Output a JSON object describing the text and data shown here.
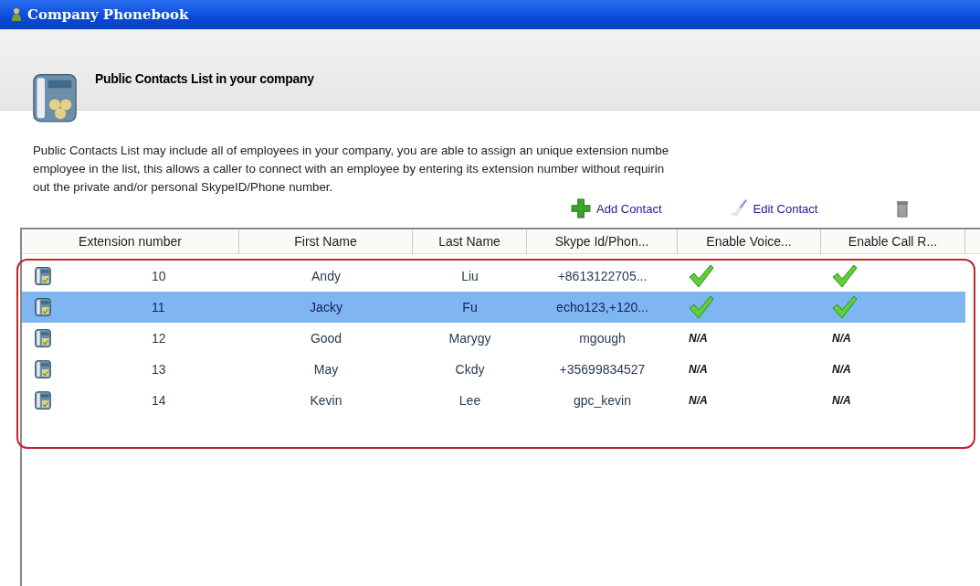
{
  "window": {
    "title": "Company Phonebook"
  },
  "header": {
    "title": "Public Contacts List in your company"
  },
  "description": [
    "Public Contacts List may include all of employees in your company, you are able to assign an unique extension numbe",
    "employee in the list, this allows a caller to connect with an employee by entering its extension number without requirin",
    "out the private and/or personal SkypeID/Phone number."
  ],
  "toolbar": [
    {
      "kind": "add",
      "label": "Add Contact"
    },
    {
      "kind": "edit",
      "label": "Edit Contact"
    },
    {
      "kind": "delete"
    }
  ],
  "table": {
    "columns": [
      "Extension number",
      "First Name",
      "Last Name",
      "Skype Id/Phon...",
      "Enable Voice...",
      "Enable Call R..."
    ],
    "rows": [
      {
        "selected": false,
        "extension": "10",
        "first_name": "Andy",
        "last_name": "Liu",
        "skype": "+8613122705...",
        "voice": {
          "kind": "check"
        },
        "call": {
          "kind": "check"
        }
      },
      {
        "selected": true,
        "extension": "11",
        "first_name": "Jacky",
        "last_name": "Fu",
        "skype": "echo123,+120...",
        "voice": {
          "kind": "check"
        },
        "call": {
          "kind": "check"
        }
      },
      {
        "selected": false,
        "extension": "12",
        "first_name": "Good",
        "last_name": "Marygy",
        "skype": "mgough",
        "voice": {
          "kind": "text",
          "text": "N/A"
        },
        "call": {
          "kind": "text",
          "text": "N/A"
        }
      },
      {
        "selected": false,
        "extension": "13",
        "first_name": "May",
        "last_name": "Ckdy",
        "skype": "+35699834527",
        "voice": {
          "kind": "text",
          "text": "N/A"
        },
        "call": {
          "kind": "text",
          "text": "N/A"
        }
      },
      {
        "selected": false,
        "extension": "14",
        "first_name": "Kevin",
        "last_name": "Lee",
        "skype": "gpc_kevin",
        "voice": {
          "kind": "text",
          "text": "N/A"
        },
        "call": {
          "kind": "text",
          "text": "N/A"
        }
      }
    ]
  }
}
